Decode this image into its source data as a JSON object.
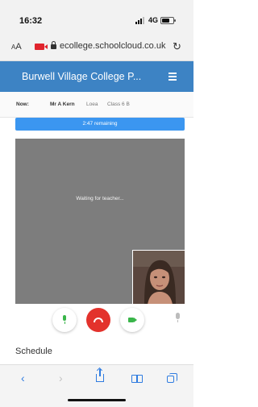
{
  "status_bar": {
    "time": "16:32",
    "network": "4G"
  },
  "address_bar": {
    "text_size_label_small": "A",
    "text_size_label_large": "A",
    "url": "ecollege.schoolcloud.co.uk",
    "camera_in_use_color": "#e0242d",
    "icons": [
      "lock-icon",
      "reload-icon",
      "camera-in-use-icon"
    ]
  },
  "app_header": {
    "title": "Burwell Village College P...",
    "background": "#3d83c4",
    "menu_icon": "hamburger-menu-icon"
  },
  "appointment": {
    "now_label": "Now:",
    "teacher": "Mr A Kern",
    "room": "Loea",
    "class": "Class 6 B"
  },
  "timer": {
    "remaining_text": "2:47 remaining",
    "color": "#3b96f0"
  },
  "video": {
    "status_text": "Waiting for teacher...",
    "background": "#7d7d7d"
  },
  "controls": {
    "mic_icon": "microphone-icon",
    "hangup_icon": "hang-up-phone-icon",
    "camera_icon": "video-camera-icon",
    "active_color": "#39b54a",
    "hangup_color": "#e3322c"
  },
  "schedule": {
    "heading": "Schedule"
  },
  "browser_toolbar": {
    "back_glyph": "‹",
    "forward_glyph": "›",
    "icons": [
      "back-icon",
      "forward-icon",
      "share-icon",
      "bookmarks-icon",
      "tabs-icon"
    ],
    "accent": "#2f7ce0"
  }
}
